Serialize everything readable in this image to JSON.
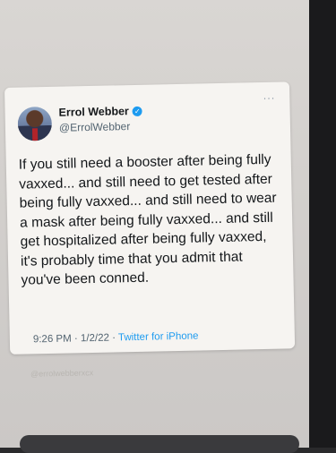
{
  "tweet": {
    "author_name": "Errol Webber",
    "handle": "@ErrolWebber",
    "more_label": "···",
    "text": "If you still need a booster after being fully vaxxed... and still need to get tested after being fully vaxxed... and still need to wear a mask after being fully vaxxed... and still get hospitalized after being fully vaxxed, it's probably time that you admit that you've been conned.",
    "time": "9:26 PM",
    "date": "1/2/22",
    "separator": "·",
    "source": "Twitter for iPhone"
  },
  "watermark": "@errolwebberxcx",
  "colors": {
    "verified": "#1d9bf0",
    "source_link": "#1d9bf0",
    "card_bg": "#f6f4f1"
  },
  "icons": {
    "verified": "verified-badge-icon",
    "more": "more-options-icon"
  }
}
